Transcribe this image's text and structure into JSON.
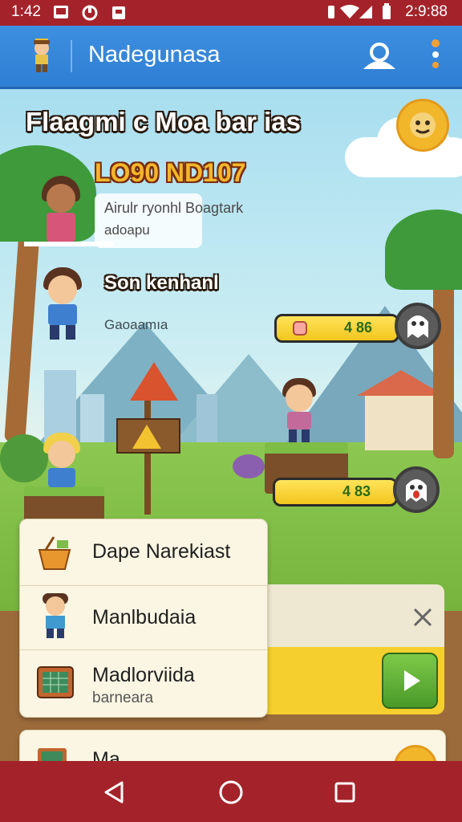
{
  "status_bar": {
    "time": "1:42",
    "clock_right": "2:9:88"
  },
  "app_bar": {
    "title": "Nadegunasa",
    "icons": [
      "character-avatar-icon",
      "profile-icon",
      "more-vert-icon"
    ]
  },
  "scene": {
    "heading": "Flaagmi c Moa bar ias",
    "logo_text": "LO90 ND107",
    "speech": {
      "line1": "Airulr ryonhl Boagtark",
      "line2": "adoapu"
    },
    "player_name": "Son kenhanl",
    "player_sub": "Gaoaamıa",
    "score_pills": [
      {
        "value": "4 86"
      },
      {
        "value": "4 83"
      }
    ],
    "colors": {
      "sky": "#a8def0",
      "grass": "#8cc851",
      "pill": "#ffe45a",
      "status_bar": "#a4232a",
      "app_bar": "#2f7fd4"
    }
  },
  "menu": {
    "items": [
      {
        "label": "Dape Narekiast",
        "icon": "basket-icon"
      },
      {
        "label": "Manlbudaia",
        "icon": "character-icon"
      },
      {
        "label": "Madlorviida",
        "sublabel": "barneara",
        "icon": "board-icon"
      }
    ],
    "partial_item_label": "Ma..."
  },
  "nav_bar": {
    "buttons": [
      "back-icon",
      "home-icon",
      "recents-icon"
    ]
  }
}
